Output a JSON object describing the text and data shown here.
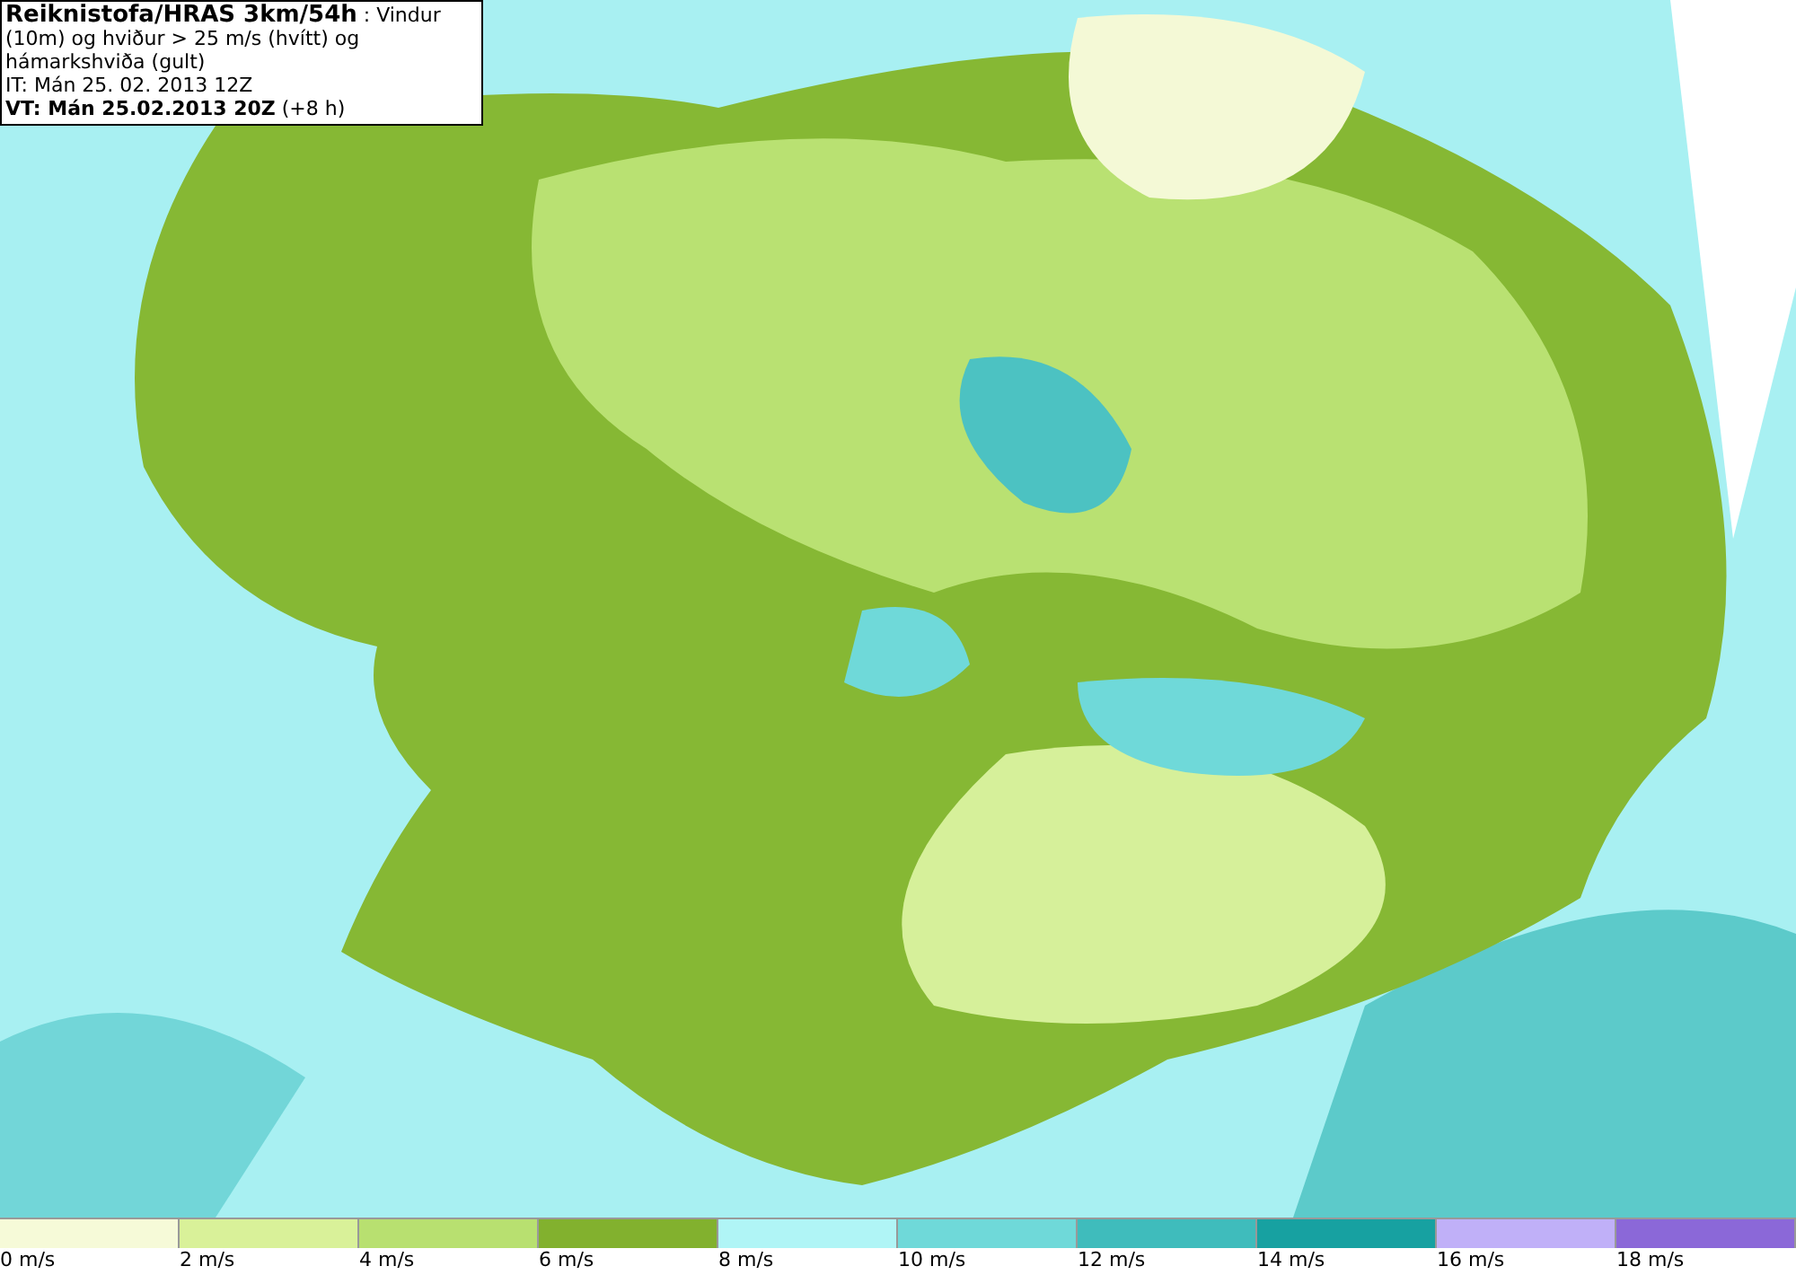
{
  "header": {
    "title": "**Reiknistofa/HRAS 3km/54h** : Vindur (10m) og hviður > 25 m/s (hvítt) og hámarkshviða (gult)",
    "initial_time": "IT: Mán 25. 02. 2013 12Z",
    "valid_time": "**VT: Mán 25.02.2013 20Z** (+8 h)"
  },
  "legend": [
    {
      "label": "0 m/s",
      "color": "#f6fad8"
    },
    {
      "label": "2 m/s",
      "color": "#d9f199"
    },
    {
      "label": "4 m/s",
      "color": "#b8e070"
    },
    {
      "label": "6 m/s",
      "color": "#82b12e"
    },
    {
      "label": "8 m/s",
      "color": "#b0f5f6"
    },
    {
      "label": "10 m/s",
      "color": "#6fd9d9"
    },
    {
      "label": "12 m/s",
      "color": "#3fbcbc"
    },
    {
      "label": "14 m/s",
      "color": "#17a1a1"
    },
    {
      "label": "16 m/s",
      "color": "#c0b0f8"
    },
    {
      "label": "18 m/s",
      "color": "#8b68d8"
    }
  ]
}
